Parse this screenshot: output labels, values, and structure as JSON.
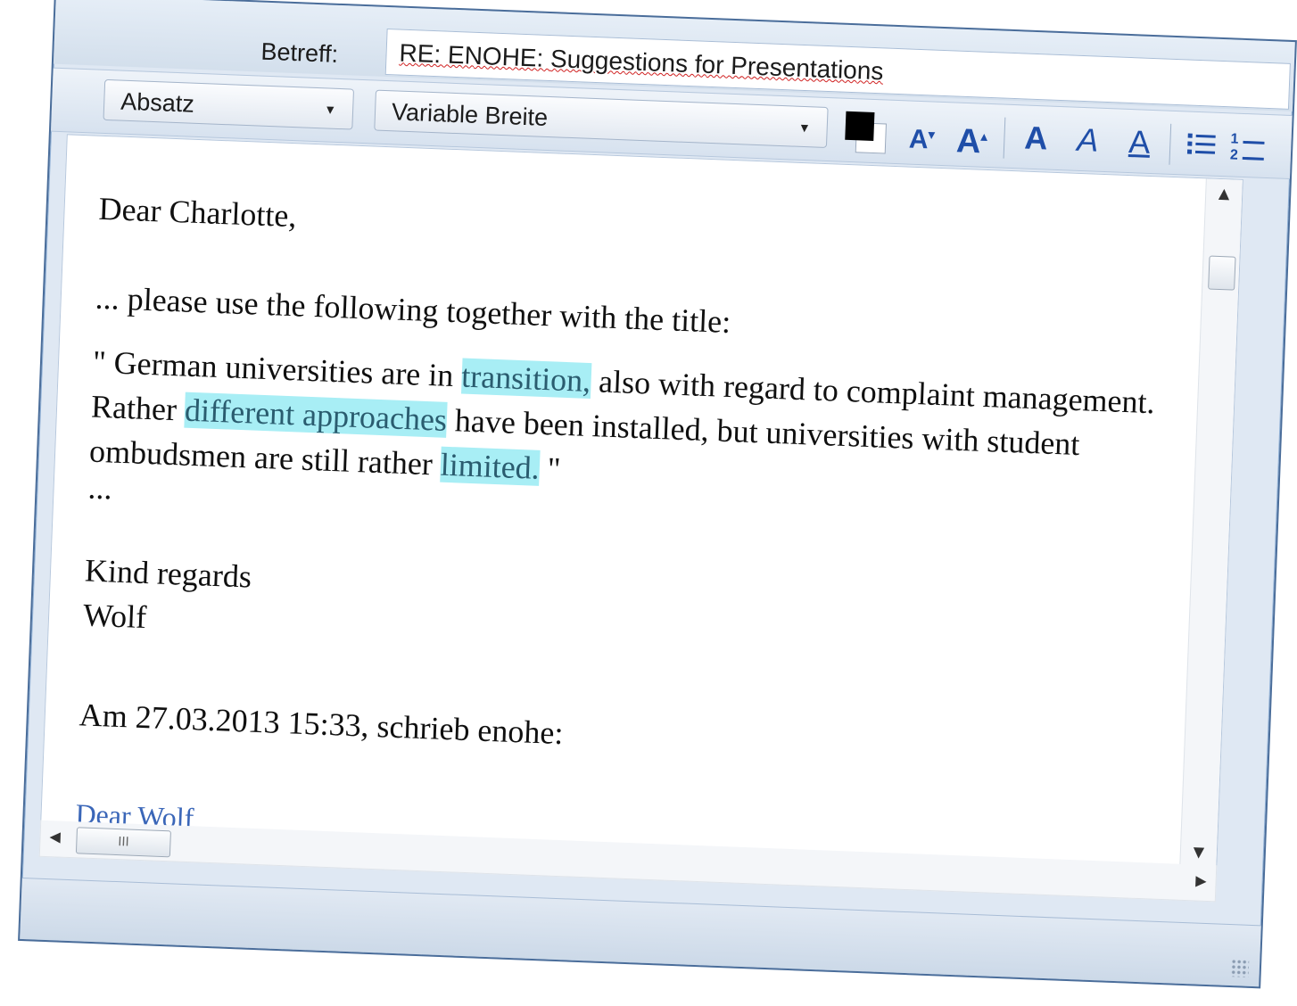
{
  "subject": {
    "label": "Betreff:",
    "value_prefix": "RE: ENOHE: ",
    "value_main": "Suggestions for Presentations"
  },
  "toolbar": {
    "paragraph_style": "Absatz",
    "font": "Variable Breite",
    "text_color": "#000000",
    "smaller_font_label": "A",
    "larger_font_label": "A",
    "bold_label": "A",
    "italic_label": "A",
    "underline_label": "A",
    "bullets_icon": "bullet-list-icon",
    "numbers_icon": "numbered-list-icon",
    "numbered_list_digits": "1 2"
  },
  "body": {
    "greeting": "Dear Charlotte,",
    "intro": "... please use the following together with the title:",
    "quote_part1": "\" German universities are in ",
    "quote_hl1": "transition,",
    "quote_part2": " also with regard to complaint management. Rather ",
    "quote_hl2": "different approaches",
    "quote_part3": " have been installed, but universities with student ombudsmen are still rather ",
    "quote_hl3": "limited.",
    "quote_end": " \"",
    "ellipsis": "...",
    "closing": "Kind regards",
    "signature": "Wolf",
    "quote_header": "Am 27.03.2013 15:33, schrieb enohe:",
    "quoted_partial": "Dear Wolf"
  },
  "colors": {
    "highlight": "#a8eef5",
    "accent": "#1f4ea8"
  },
  "scrollbar": {
    "hthumb_label": "III"
  }
}
